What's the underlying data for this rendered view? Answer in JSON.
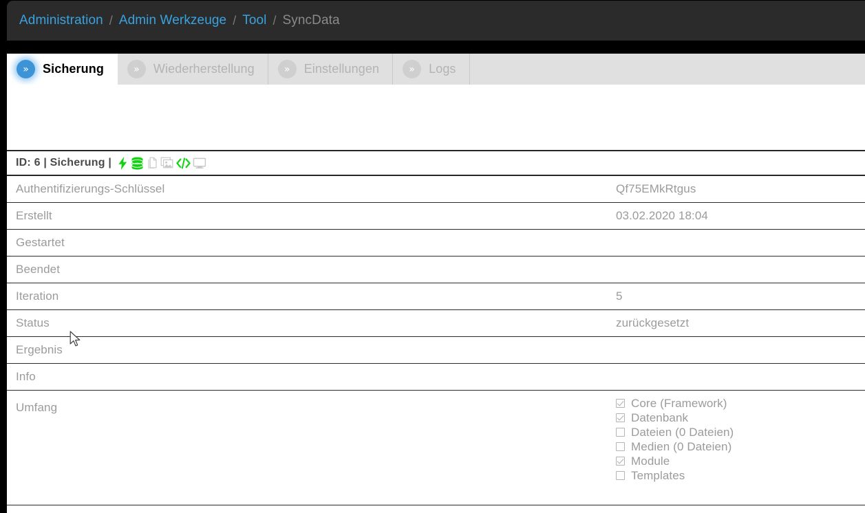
{
  "breadcrumb": {
    "separator": "/",
    "items": [
      {
        "label": "Administration",
        "type": "link"
      },
      {
        "label": "Admin Werkzeuge",
        "type": "link"
      },
      {
        "label": "Tool",
        "type": "link"
      },
      {
        "label": "SyncData",
        "type": "current"
      }
    ]
  },
  "tabs": [
    {
      "label": "Sicherung",
      "bullet": "»",
      "active": true
    },
    {
      "label": "Wiederherstellung",
      "bullet": "»",
      "active": false
    },
    {
      "label": "Einstellungen",
      "bullet": "»",
      "active": false
    },
    {
      "label": "Logs",
      "bullet": "»",
      "active": false
    }
  ],
  "record": {
    "header_text": "ID: 6 | Sicherung |",
    "icons": [
      {
        "name": "lightning-bolt-icon",
        "color": "#11d411",
        "state": "active"
      },
      {
        "name": "database-icon",
        "color": "#11d411",
        "state": "active"
      },
      {
        "name": "file-icon",
        "color": "#c9c9c9",
        "state": "inactive"
      },
      {
        "name": "image-icon",
        "color": "#c9c9c9",
        "state": "inactive"
      },
      {
        "name": "code-icon",
        "color": "#11d411",
        "state": "active"
      },
      {
        "name": "monitor-icon",
        "color": "#c9c9c9",
        "state": "inactive"
      }
    ],
    "rows": [
      {
        "label": "Authentifizierungs-Schlüssel",
        "value": "Qf75EMkRtgus"
      },
      {
        "label": "Erstellt",
        "value": "03.02.2020 18:04"
      },
      {
        "label": "Gestartet",
        "value": ""
      },
      {
        "label": "Beendet",
        "value": ""
      },
      {
        "label": "Iteration",
        "value": "5"
      },
      {
        "label": "Status",
        "value": "zurückgesetzt"
      },
      {
        "label": "Ergebnis",
        "value": ""
      },
      {
        "label": "Info",
        "value": ""
      }
    ],
    "umfang": {
      "label": "Umfang",
      "options": [
        {
          "label": "Core (Framework)",
          "checked": true
        },
        {
          "label": "Datenbank",
          "checked": true
        },
        {
          "label": "Dateien (0 Dateien)",
          "checked": false
        },
        {
          "label": "Medien (0 Dateien)",
          "checked": false
        },
        {
          "label": "Module",
          "checked": true
        },
        {
          "label": "Templates",
          "checked": false
        }
      ]
    }
  },
  "colors": {
    "header_bg": "#2b2b2b",
    "link": "#38a3e0",
    "muted_text": "#9b9b9b",
    "tab_bg": "#e0e0e0",
    "accent_blue": "#3c93d6",
    "icon_green": "#11d411",
    "icon_grey": "#c9c9c9"
  }
}
